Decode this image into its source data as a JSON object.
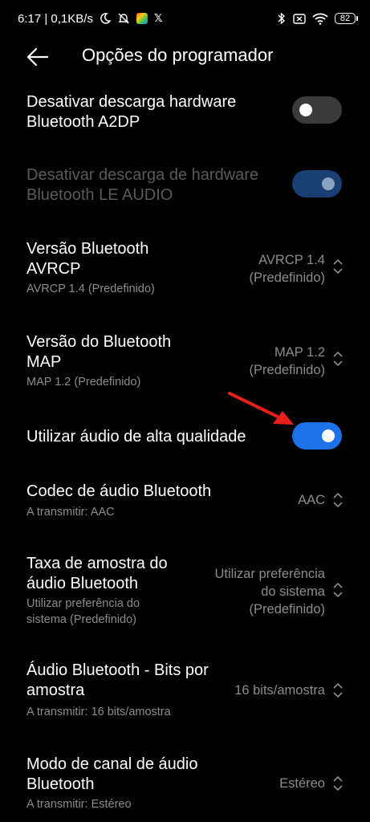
{
  "status_bar": {
    "time_speed": "6:17 | 0,1KB/s",
    "battery": "82"
  },
  "header": {
    "title": "Opções do programador"
  },
  "settings": [
    {
      "title": "Desativar descarga hardware Bluetooth A2DP",
      "toggle": "off"
    },
    {
      "title": "Desativar descarga de hardware Bluetooth LE AUDIO",
      "toggle": "on",
      "disabled": true
    },
    {
      "title": "Versão Bluetooth AVRCP",
      "summary": "AVRCP 1.4 (Predefinido)",
      "value_line1": "AVRCP 1.4",
      "value_line2": "(Predefinido)"
    },
    {
      "title": "Versão do Bluetooth MAP",
      "summary": "MAP 1.2 (Predefinido)",
      "value_line1": "MAP 1.2",
      "value_line2": "(Predefinido)"
    },
    {
      "title": "Utilizar áudio de alta qualidade",
      "toggle": "on"
    },
    {
      "title": "Codec de áudio Bluetooth",
      "summary": "A transmitir: AAC",
      "value_line1": "AAC"
    },
    {
      "title": "Taxa de amostra do áudio Bluetooth",
      "summary": "Utilizar preferência do sistema (Predefinido)",
      "value_line1": "Utilizar preferência",
      "value_line2": "do sistema",
      "value_line3": "(Predefinido)"
    },
    {
      "title": "Áudio Bluetooth - Bits por amostra",
      "summary": "A transmitir: 16 bits/amostra",
      "value_line1": "16 bits/amostra"
    },
    {
      "title": "Modo de canal de áudio Bluetooth",
      "summary": "A transmitir: Estéreo",
      "value_line1": "Estéreo"
    }
  ],
  "colors": {
    "accent": "#1d72e8",
    "annotation_arrow": "#e8201c"
  }
}
